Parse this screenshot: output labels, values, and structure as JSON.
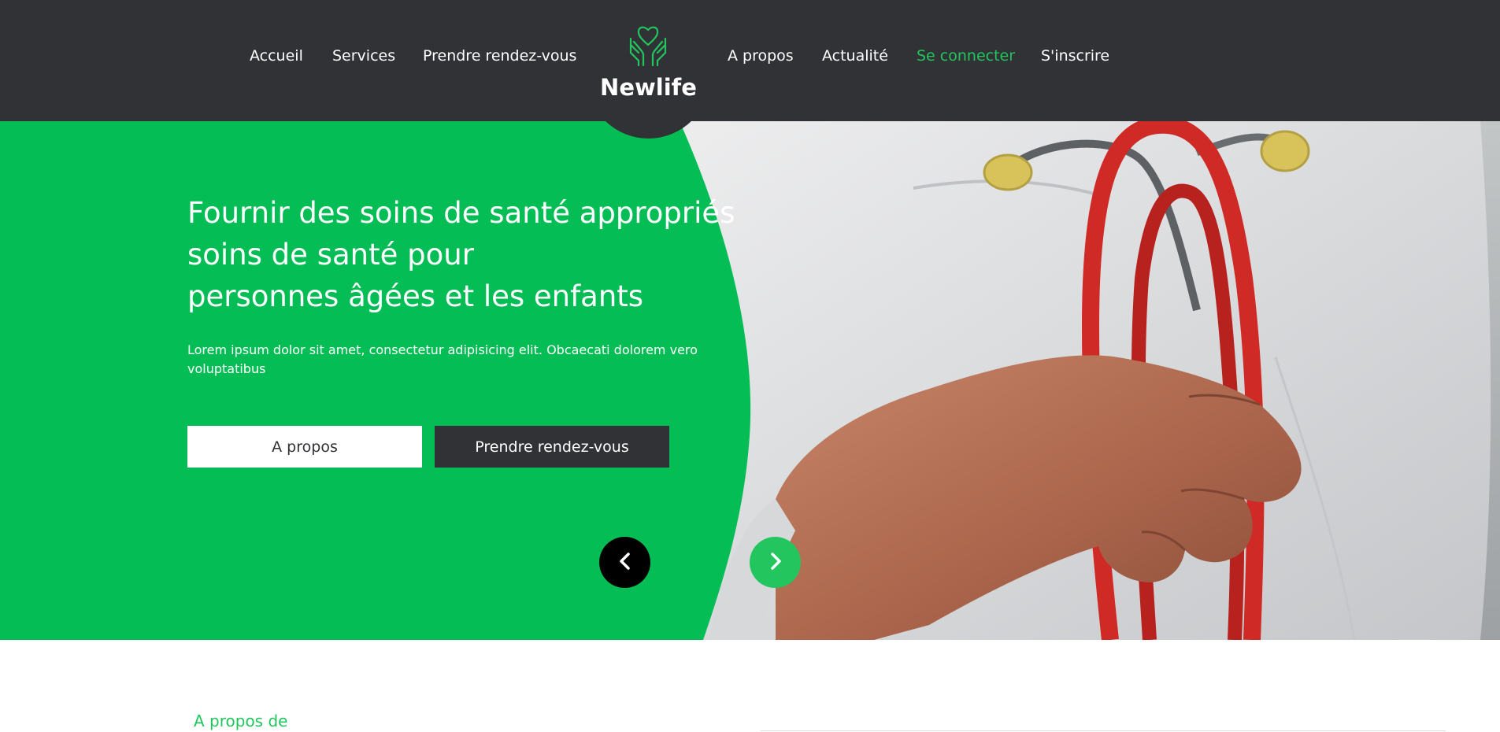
{
  "nav": {
    "left": [
      "Accueil",
      "Services",
      "Prendre rendez-vous"
    ],
    "right": [
      "A propos",
      "Actualité",
      "Se connecter",
      "S'inscrire"
    ],
    "active": "Se connecter"
  },
  "logo": {
    "text": "Newlife",
    "icon": "hands-heart-icon"
  },
  "hero": {
    "title_lines": [
      "Fournir des soins de santé appropriés",
      "soins de santé pour",
      "personnes âgées et les enfants"
    ],
    "text": "Lorem ipsum dolor sit amet, consectetur adipisicing elit. Obcaecati dolorem vero voluptatibus",
    "buttons": {
      "about": "A propos",
      "appointment": "Prendre rendez-vous"
    },
    "prev_icon": "chevron-left-icon",
    "next_icon": "chevron-right-icon",
    "image": "doctor-with-stethoscope"
  },
  "about": {
    "label": "A propos de"
  },
  "colors": {
    "primary_green": "#22c55e",
    "hero_green": "#04be55",
    "dark": "#313236",
    "white": "#ffffff"
  }
}
